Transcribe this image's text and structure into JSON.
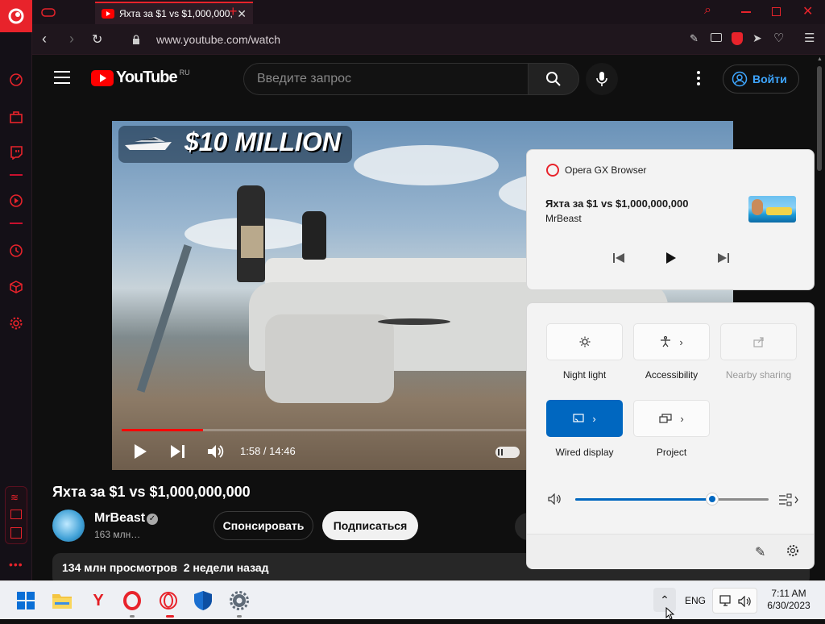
{
  "browser": {
    "tab_title": "Яхта за $1 vs $1,000,000,000",
    "url": "www.youtube.com/watch"
  },
  "youtube": {
    "logo_text": "YouTube",
    "region": "RU",
    "search_placeholder": "Введите запрос",
    "login_label": "Войти",
    "video": {
      "overlay_text": "$10 MILLION",
      "progress_fraction": 0.135,
      "time_display": "1:58 / 14:46",
      "title": "Яхта за $1 vs $1,000,000,000"
    },
    "channel": {
      "name": "MrBeast",
      "subscribers": "163 млн…"
    },
    "sponsor_label": "Спонсировать",
    "subscribe_label": "Подписаться",
    "stats": "134 млн просмотров  2 недели назад"
  },
  "media_flyout": {
    "app_name": "Opera GX Browser",
    "track_title": "Яхта за $1 vs $1,000,000,000",
    "artist": "MrBeast"
  },
  "quick_settings": {
    "tiles": [
      {
        "label": "Night light",
        "icon": "brightness-icon",
        "state": "off"
      },
      {
        "label": "Accessibility",
        "icon": "accessibility-icon",
        "state": "off"
      },
      {
        "label": "Nearby sharing",
        "icon": "share-icon",
        "state": "disabled"
      },
      {
        "label": "Wired display",
        "icon": "cast-icon",
        "state": "on"
      },
      {
        "label": "Project",
        "icon": "project-icon",
        "state": "off"
      }
    ],
    "volume_fraction": 0.71
  },
  "taskbar": {
    "language": "ENG",
    "time": "7:11 AM",
    "date": "6/30/2023"
  },
  "colors": {
    "opera_red": "#e8232b",
    "youtube_red": "#ff0000",
    "windows_accent": "#0067c0",
    "link_blue": "#3ea6ff"
  }
}
